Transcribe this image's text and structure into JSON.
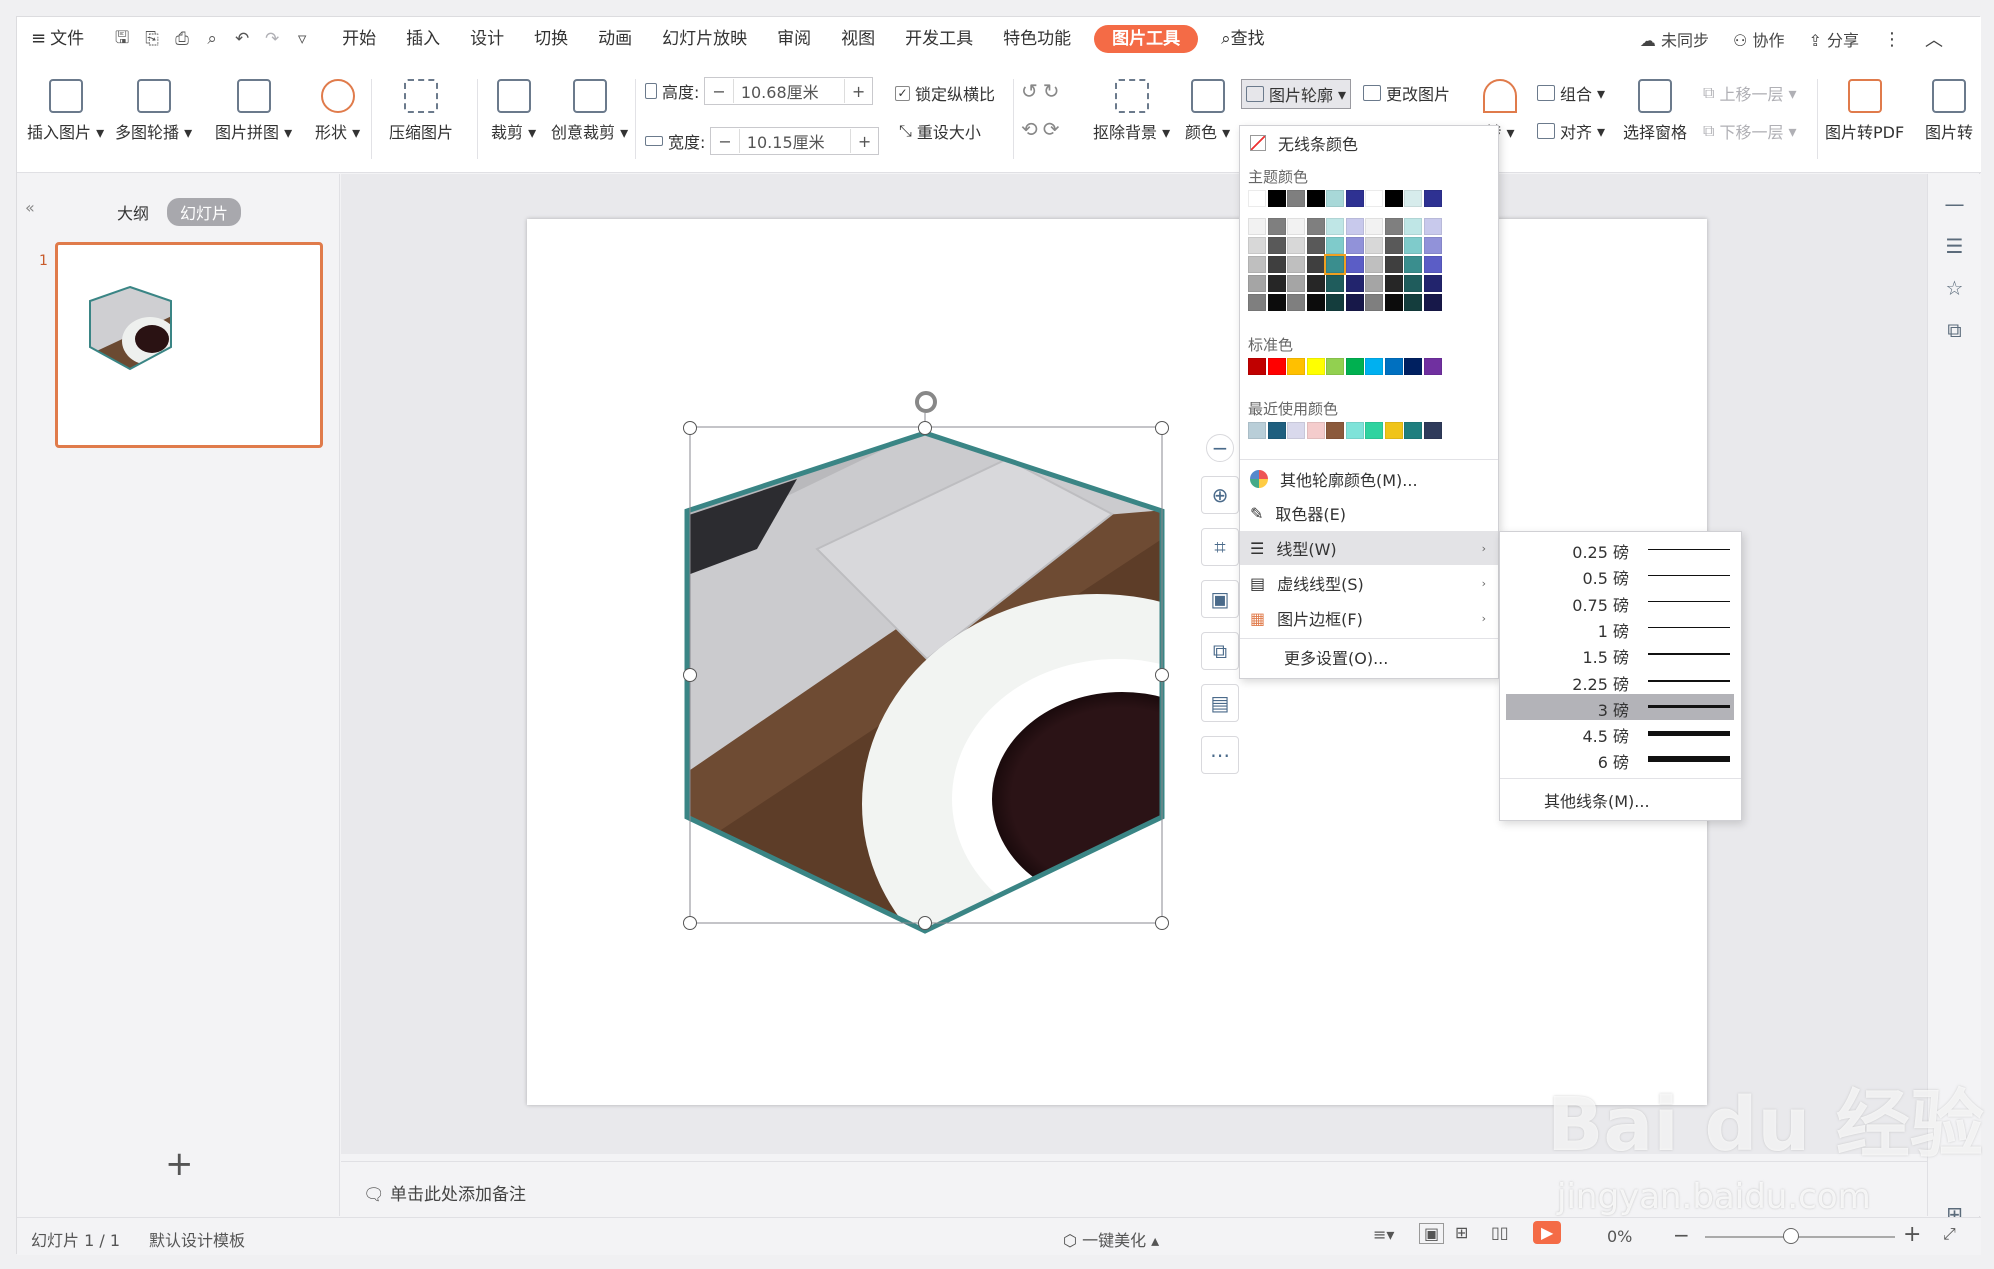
{
  "menubar": {
    "file": "文件",
    "tabs": [
      {
        "label": "开始",
        "active": false
      },
      {
        "label": "插入",
        "active": false
      },
      {
        "label": "设计",
        "active": false
      },
      {
        "label": "切换",
        "active": false
      },
      {
        "label": "动画",
        "active": false
      },
      {
        "label": "幻灯片放映",
        "active": false
      },
      {
        "label": "审阅",
        "active": false
      },
      {
        "label": "视图",
        "active": false
      },
      {
        "label": "开发工具",
        "active": false
      },
      {
        "label": "特色功能",
        "active": false
      },
      {
        "label": "图片工具",
        "active": true
      }
    ],
    "search": "查找",
    "sync": "未同步",
    "collab": "协作",
    "share": "分享"
  },
  "ribbon": {
    "insert_picture": "插入图片",
    "multi_carousel": "多图轮播",
    "picture_collage": "图片拼图",
    "shape": "形状",
    "compress": "压缩图片",
    "crop": "裁剪",
    "creative_crop": "创意裁剪",
    "height_label": "高度:",
    "height_value": "10.68厘米",
    "width_label": "宽度:",
    "width_value": "10.15厘米",
    "lock_ratio": "锁定纵横比",
    "reset_size": "重设大小",
    "remove_bg": "抠除背景",
    "color": "颜色",
    "outline": "图片轮廓",
    "change_picture": "更改图片",
    "rotate": "转",
    "group": "组合",
    "align": "对齐",
    "select_pane": "选择窗格",
    "move_up": "上移一层",
    "move_down": "下移一层",
    "to_pdf": "图片转PDF",
    "to_more": "图片转"
  },
  "leftpanel": {
    "tab_outline": "大纲",
    "tab_slides": "幻灯片",
    "slide_number": "1",
    "add": "+"
  },
  "notes": {
    "placeholder": "单击此处添加备注"
  },
  "statusbar": {
    "slide_info": "幻灯片 1 / 1",
    "template": "默认设计模板",
    "beautify": "一键美化",
    "zoom": "0%"
  },
  "dropdown": {
    "no_line": "无线条颜色",
    "theme_colors": "主题颜色",
    "standard_colors": "标准色",
    "recent_colors": "最近使用颜色",
    "more_colors": "其他轮廓颜色(M)...",
    "eyedropper": "取色器(E)",
    "line_type": "线型(W)",
    "dash_type": "虚线线型(S)",
    "picture_border": "图片边框(F)",
    "more_settings": "更多设置(O)...",
    "theme_top_row": [
      "#ffffff",
      "#000000",
      "#7f7f7f",
      "#000000",
      "#a8d8d8",
      "#2e3192",
      "#ffffff",
      "#000000",
      "#d7ecec",
      "#2e3192"
    ],
    "theme_shades": [
      [
        "#f2f2f2",
        "#7f7f7f",
        "#f2f2f2",
        "#7f7f7f",
        "#bfe6e6",
        "#c8c9ec",
        "#f2f2f2",
        "#7f7f7f",
        "#bfe6e6",
        "#c8c9ec"
      ],
      [
        "#d8d8d8",
        "#595959",
        "#d8d8d8",
        "#595959",
        "#7fcbcb",
        "#9192d9",
        "#d8d8d8",
        "#595959",
        "#7fcbcb",
        "#9192d9"
      ],
      [
        "#bfbfbf",
        "#3f3f3f",
        "#bfbfbf",
        "#3f3f3f",
        "#3a8e8e",
        "#5b5dc6",
        "#bfbfbf",
        "#3f3f3f",
        "#3a8e8e",
        "#5b5dc6"
      ],
      [
        "#a5a5a5",
        "#262626",
        "#a5a5a5",
        "#262626",
        "#1f5c5c",
        "#22246d",
        "#a5a5a5",
        "#262626",
        "#1f5c5c",
        "#22246d"
      ],
      [
        "#7f7f7f",
        "#0c0c0c",
        "#7f7f7f",
        "#0c0c0c",
        "#143d3d",
        "#171849",
        "#7f7f7f",
        "#0c0c0c",
        "#143d3d",
        "#171849"
      ]
    ],
    "standard": [
      "#c00000",
      "#ff0000",
      "#ffc000",
      "#ffff00",
      "#92d050",
      "#00b050",
      "#00b0f0",
      "#0070c0",
      "#002060",
      "#7030a0"
    ],
    "recent": [
      "#b9ced8",
      "#1f5f7f",
      "#d9d9ec",
      "#f4cccc",
      "#8b5a3c",
      "#7fe3d9",
      "#2fd3a0",
      "#f0c419",
      "#1f7f7f",
      "#2f3b5b"
    ]
  },
  "submenu": {
    "widths": [
      {
        "label": "0.25 磅",
        "pt": 0.25,
        "selected": false
      },
      {
        "label": "0.5 磅",
        "pt": 0.5,
        "selected": false
      },
      {
        "label": "0.75 磅",
        "pt": 0.75,
        "selected": false
      },
      {
        "label": "1 磅",
        "pt": 1,
        "selected": false
      },
      {
        "label": "1.5 磅",
        "pt": 1.5,
        "selected": false
      },
      {
        "label": "2.25 磅",
        "pt": 2.25,
        "selected": false
      },
      {
        "label": "3 磅",
        "pt": 3,
        "selected": true
      },
      {
        "label": "4.5 磅",
        "pt": 4.5,
        "selected": false
      },
      {
        "label": "6 磅",
        "pt": 6,
        "selected": false
      }
    ],
    "more_lines": "其他线条(M)..."
  },
  "watermark": {
    "brand": "Bai du 经验",
    "url": "jingyan.baidu.com"
  },
  "colors": {
    "accent": "#f46b46",
    "hexagon_border": "#3a8585",
    "thumb_border": "#e07b4b"
  }
}
